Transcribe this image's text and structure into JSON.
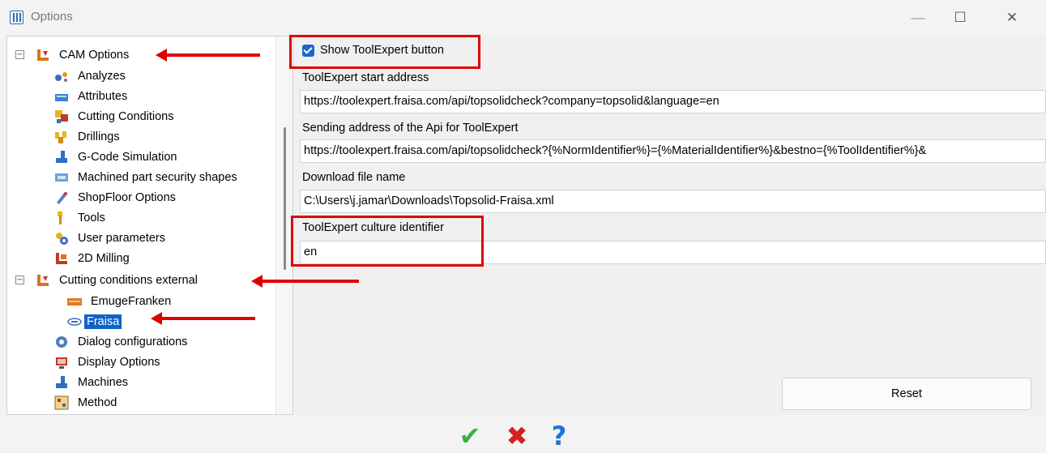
{
  "window": {
    "title": "Options",
    "minimize_glyph": "—",
    "maximize_glyph": "☐",
    "close_glyph": "✕"
  },
  "tree": {
    "items": [
      {
        "label": "CAM Options",
        "icon": "cam-options-icon",
        "expander": "−"
      },
      {
        "label": "Analyzes",
        "icon": "analyzes-icon"
      },
      {
        "label": "Attributes",
        "icon": "attributes-icon"
      },
      {
        "label": "Cutting Conditions",
        "icon": "cutting-conditions-icon"
      },
      {
        "label": "Drillings",
        "icon": "drillings-icon"
      },
      {
        "label": "G-Code Simulation",
        "icon": "gcode-simulation-icon"
      },
      {
        "label": "Machined part security shapes",
        "icon": "security-shapes-icon"
      },
      {
        "label": "ShopFloor Options",
        "icon": "shopfloor-icon"
      },
      {
        "label": "Tools",
        "icon": "tools-icon"
      },
      {
        "label": "User parameters",
        "icon": "user-parameters-icon"
      },
      {
        "label": "2D Milling",
        "icon": "milling-2d-icon"
      },
      {
        "label": "Cutting conditions external",
        "icon": "cutting-conditions-external-icon",
        "expander": "−"
      },
      {
        "label": "EmugeFranken",
        "icon": "emugefranken-logo-icon"
      },
      {
        "label": "Fraisa",
        "icon": "fraisa-logo-icon",
        "selected": true
      },
      {
        "label": "Dialog configurations",
        "icon": "dialog-configurations-icon"
      },
      {
        "label": "Display Options",
        "icon": "display-options-icon"
      },
      {
        "label": "Machines",
        "icon": "machines-icon"
      },
      {
        "label": "Method",
        "icon": "method-icon"
      }
    ]
  },
  "settings": {
    "show_button_label": "Show ToolExpert button",
    "show_button_checked": true,
    "start_address_label": "ToolExpert start address",
    "start_address_value": "https://toolexpert.fraisa.com/api/topsolidcheck?company=topsolid&language=en",
    "api_address_label": "Sending address of the Api for ToolExpert",
    "api_address_value": "https://toolexpert.fraisa.com/api/topsolidcheck?{%NormIdentifier%}={%MaterialIdentifier%}&bestno={%ToolIdentifier%}&",
    "download_label": "Download file name",
    "download_value": "C:\\Users\\j.jamar\\Downloads\\Topsolid-Fraisa.xml",
    "culture_label": "ToolExpert culture identifier",
    "culture_value": "en",
    "reset_label": "Reset"
  },
  "footer": {
    "ok_glyph": "✔",
    "cancel_glyph": "✖",
    "help_glyph": "?"
  },
  "colors": {
    "accent": "#0d63c7",
    "annotation": "#e00000",
    "ok": "#3cb043",
    "cancel": "#d42020",
    "help": "#1e73d6"
  }
}
